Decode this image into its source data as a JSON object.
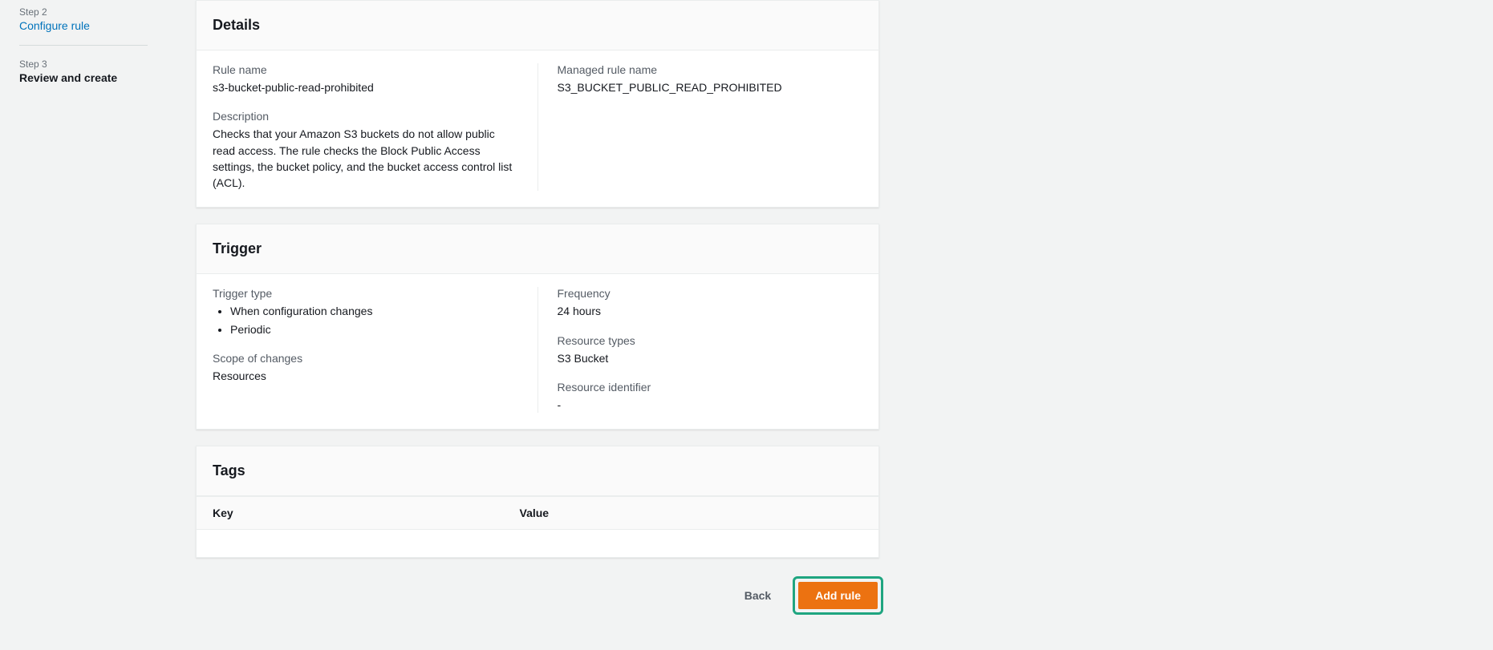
{
  "sidebar": {
    "step2_label": "Step 2",
    "step2_title": "Configure rule",
    "step3_label": "Step 3",
    "step3_title": "Review and create"
  },
  "details": {
    "heading": "Details",
    "rule_name_label": "Rule name",
    "rule_name_value": "s3-bucket-public-read-prohibited",
    "description_label": "Description",
    "description_value": "Checks that your Amazon S3 buckets do not allow public read access. The rule checks the Block Public Access settings, the bucket policy, and the bucket access control list (ACL).",
    "managed_rule_name_label": "Managed rule name",
    "managed_rule_name_value": "S3_BUCKET_PUBLIC_READ_PROHIBITED"
  },
  "trigger": {
    "heading": "Trigger",
    "trigger_type_label": "Trigger type",
    "trigger_type_items": [
      "When configuration changes",
      "Periodic"
    ],
    "scope_label": "Scope of changes",
    "scope_value": "Resources",
    "frequency_label": "Frequency",
    "frequency_value": "24 hours",
    "resource_types_label": "Resource types",
    "resource_types_value": "S3 Bucket",
    "resource_identifier_label": "Resource identifier",
    "resource_identifier_value": "-"
  },
  "tags": {
    "heading": "Tags",
    "key_header": "Key",
    "value_header": "Value"
  },
  "actions": {
    "back": "Back",
    "add_rule": "Add rule"
  }
}
